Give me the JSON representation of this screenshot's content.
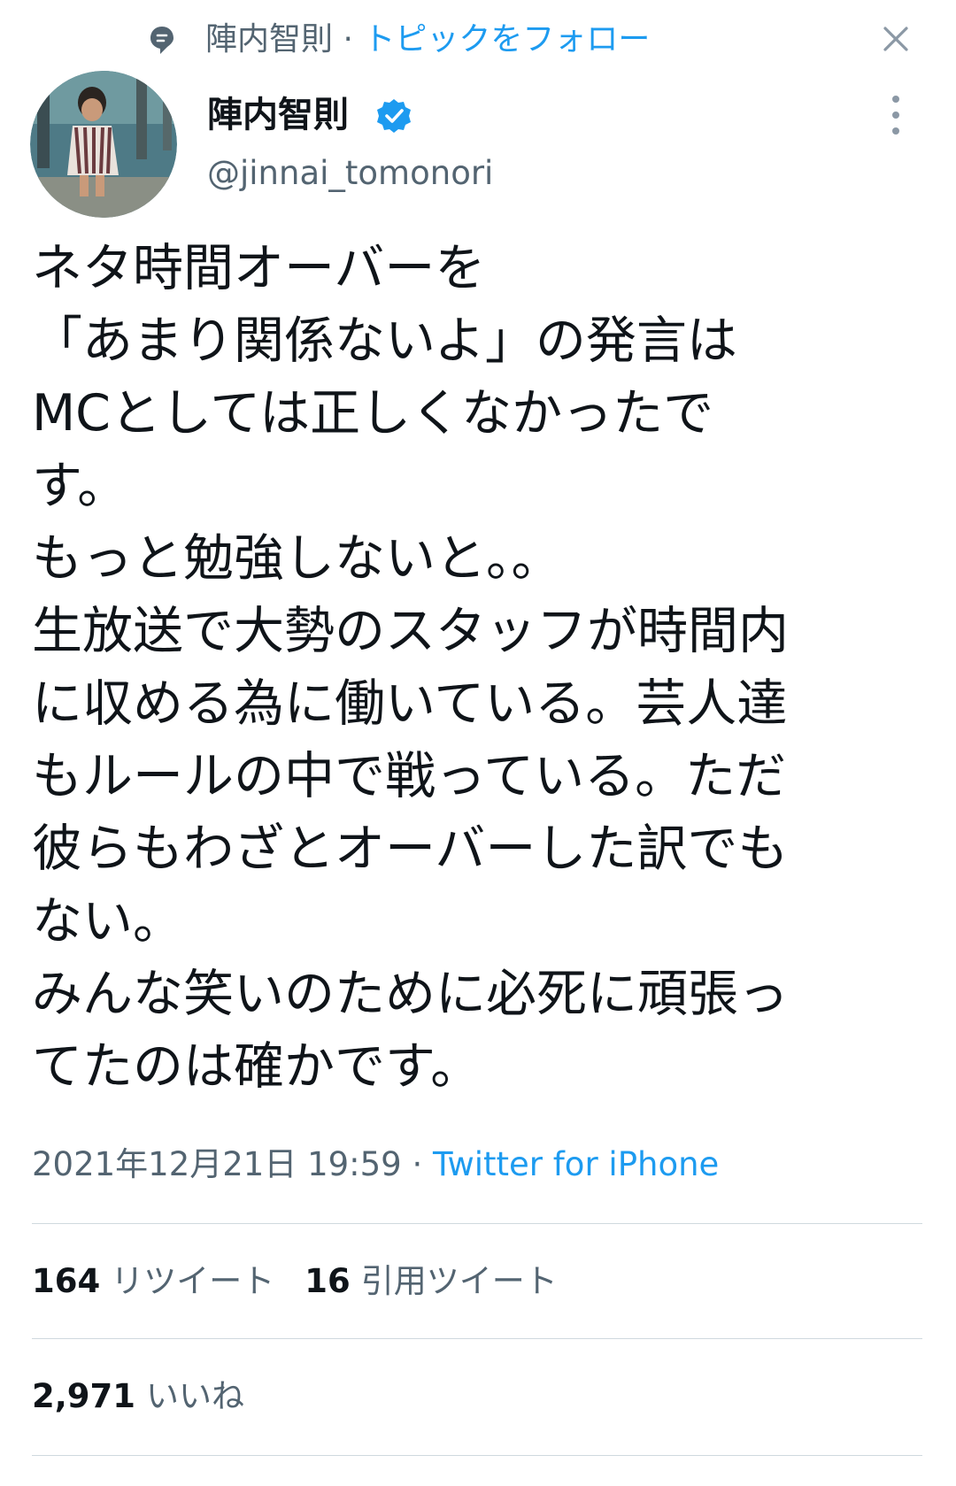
{
  "topic": {
    "name": "陣内智則",
    "separator": "·",
    "follow_label": "トピックをフォロー"
  },
  "author": {
    "display_name": "陣内智則",
    "handle": "@jinnai_tomonori",
    "verified": true
  },
  "tweet": {
    "lines": [
      "ネタ時間オーバーを",
      "「あまり関係ないよ」の発言は",
      "MCとしては正しくなかったで",
      "す。",
      "もっと勉強しないと。。",
      "生放送で大勢のスタッフが時間内",
      "に収める為に働いている。芸人達",
      "もルールの中で戦っている。ただ",
      "彼らもわざとオーバーした訳でも",
      "ない。",
      "みんな笑いのために必死に頑張っ",
      "てたのは確かです。"
    ],
    "timestamp": "2021年12月21日 19:59",
    "separator": " · ",
    "source": "Twitter for iPhone"
  },
  "stats": {
    "retweets_count": "164",
    "retweets_label": "リツイート",
    "quotes_count": "16",
    "quotes_label": "引用ツイート",
    "likes_count": "2,971",
    "likes_label": "いいね"
  },
  "colors": {
    "accent": "#1d9bf0",
    "secondary_text": "#536471",
    "divider": "#cfd9de",
    "verified_badge": "#1d9bf0"
  },
  "icons": {
    "topic": "topic-icon",
    "close": "close-icon",
    "verified": "verified-badge-icon",
    "more": "more-vertical-icon"
  }
}
